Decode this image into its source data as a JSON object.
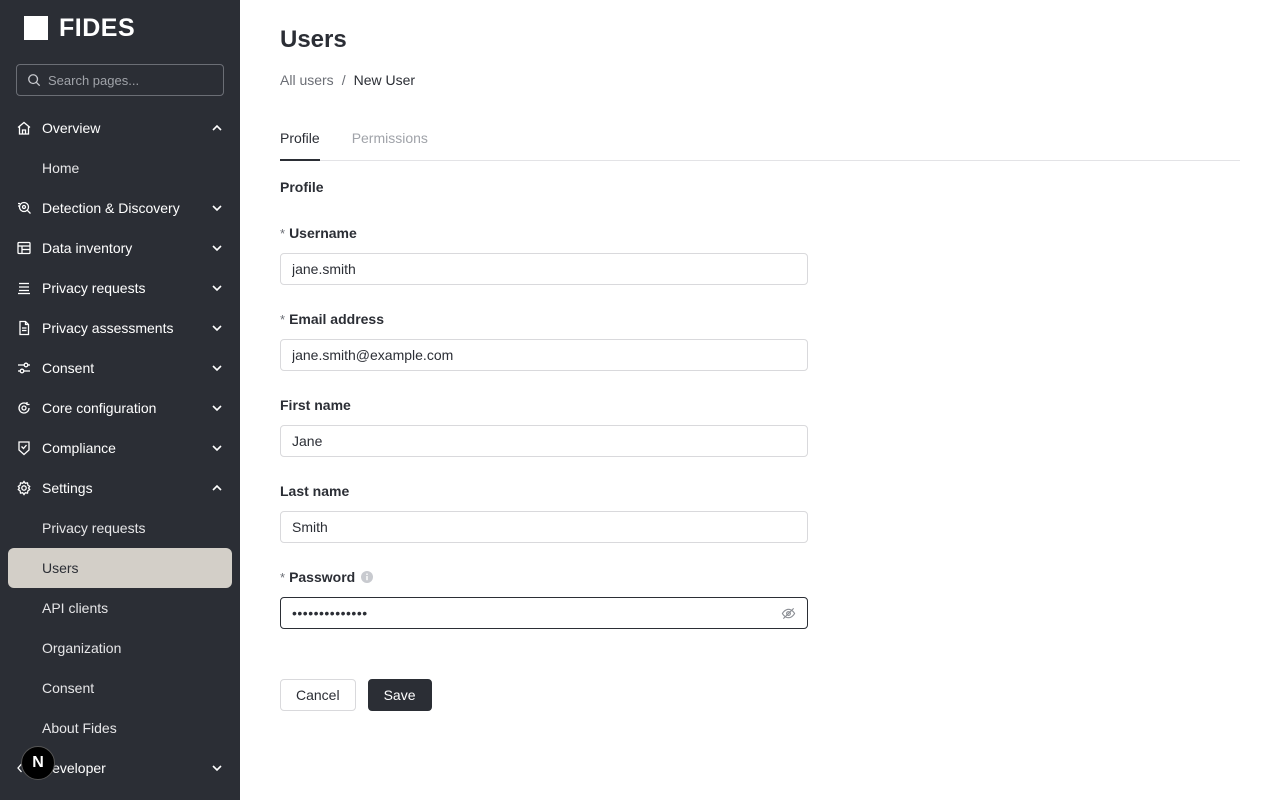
{
  "app": {
    "logo_text": "FIDES"
  },
  "search": {
    "placeholder": "Search pages..."
  },
  "nav": {
    "overview": "Overview",
    "home": "Home",
    "detection": "Detection & Discovery",
    "data_inventory": "Data inventory",
    "privacy_requests": "Privacy requests",
    "privacy_assessments": "Privacy assessments",
    "consent": "Consent",
    "core_configuration": "Core configuration",
    "compliance": "Compliance",
    "settings": "Settings",
    "settings_items": [
      "Privacy requests",
      "Users",
      "API clients",
      "Organization",
      "Consent",
      "About Fides"
    ],
    "developer": "Developer",
    "active_item": "Users"
  },
  "badge": {
    "letter": "N"
  },
  "page": {
    "title": "Users",
    "breadcrumb": {
      "parent": "All users",
      "separator": "/",
      "current": "New User"
    },
    "tabs": [
      "Profile",
      "Permissions"
    ],
    "active_tab": "Profile",
    "section_title": "Profile"
  },
  "form": {
    "required_mark": "*",
    "username": {
      "label": "Username",
      "value": "jane.smith"
    },
    "email": {
      "label": "Email address",
      "value": "jane.smith@example.com"
    },
    "first_name": {
      "label": "First name",
      "value": "Jane"
    },
    "last_name": {
      "label": "Last name",
      "value": "Smith"
    },
    "password": {
      "label": "Password",
      "value": "••••••••••••••"
    }
  },
  "actions": {
    "cancel": "Cancel",
    "save": "Save"
  },
  "colors": {
    "sidebar_bg": "#2b2e35",
    "active_item_bg": "#d3cfc8",
    "primary": "#2b2e35"
  }
}
